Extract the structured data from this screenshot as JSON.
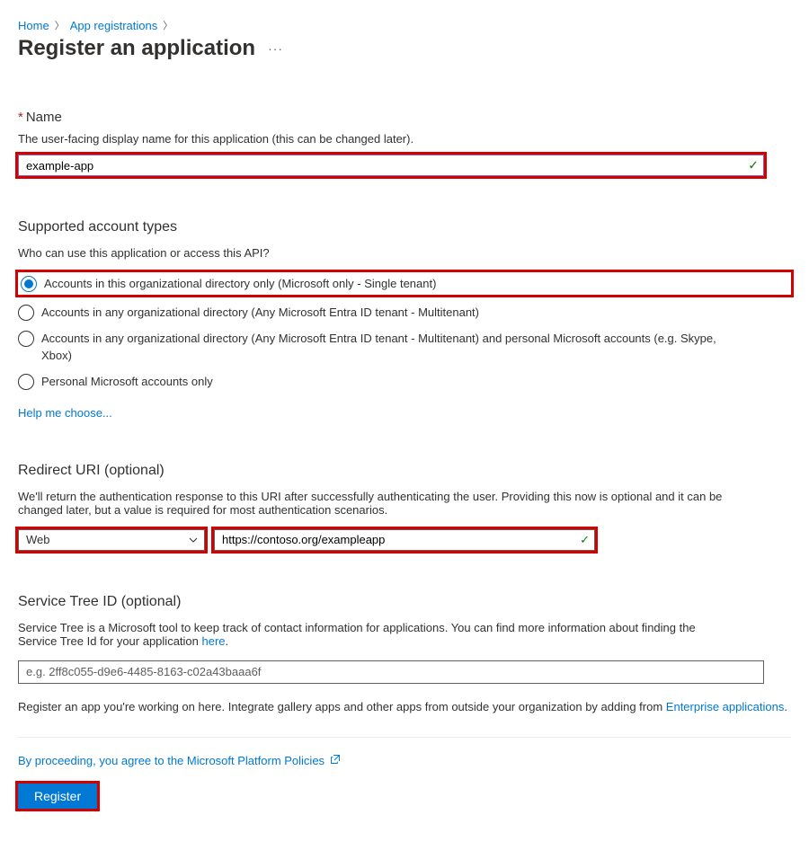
{
  "breadcrumb": {
    "home": "Home",
    "app_registrations": "App registrations"
  },
  "page_title": "Register an application",
  "name_section": {
    "label": "Name",
    "description": "The user-facing display name for this application (this can be changed later).",
    "value": "example-app"
  },
  "account_types": {
    "heading": "Supported account types",
    "subtext": "Who can use this application or access this API?",
    "options": [
      "Accounts in this organizational directory only (Microsoft only - Single tenant)",
      "Accounts in any organizational directory (Any Microsoft Entra ID tenant - Multitenant)",
      "Accounts in any organizational directory (Any Microsoft Entra ID tenant - Multitenant) and personal Microsoft accounts (e.g. Skype, Xbox)",
      "Personal Microsoft accounts only"
    ],
    "help_link": "Help me choose..."
  },
  "redirect_uri": {
    "heading": "Redirect URI (optional)",
    "description": "We'll return the authentication response to this URI after successfully authenticating the user. Providing this now is optional and it can be changed later, but a value is required for most authentication scenarios.",
    "platform": "Web",
    "uri_value": "https://contoso.org/exampleapp"
  },
  "service_tree": {
    "heading": "Service Tree ID (optional)",
    "description_pre": "Service Tree is a Microsoft tool to keep track of contact information for applications. You can find more information about finding the Service Tree Id for your application ",
    "description_link": "here",
    "description_post": ".",
    "placeholder": "e.g. 2ff8c055-d9e6-4485-8163-c02a43baaa6f"
  },
  "footer": {
    "note_pre": "Register an app you're working on here. Integrate gallery apps and other apps from outside your organization by adding from ",
    "note_link": "Enterprise applications",
    "note_post": ".",
    "policy_text": "By proceeding, you agree to the Microsoft Platform Policies",
    "register_button": "Register"
  }
}
